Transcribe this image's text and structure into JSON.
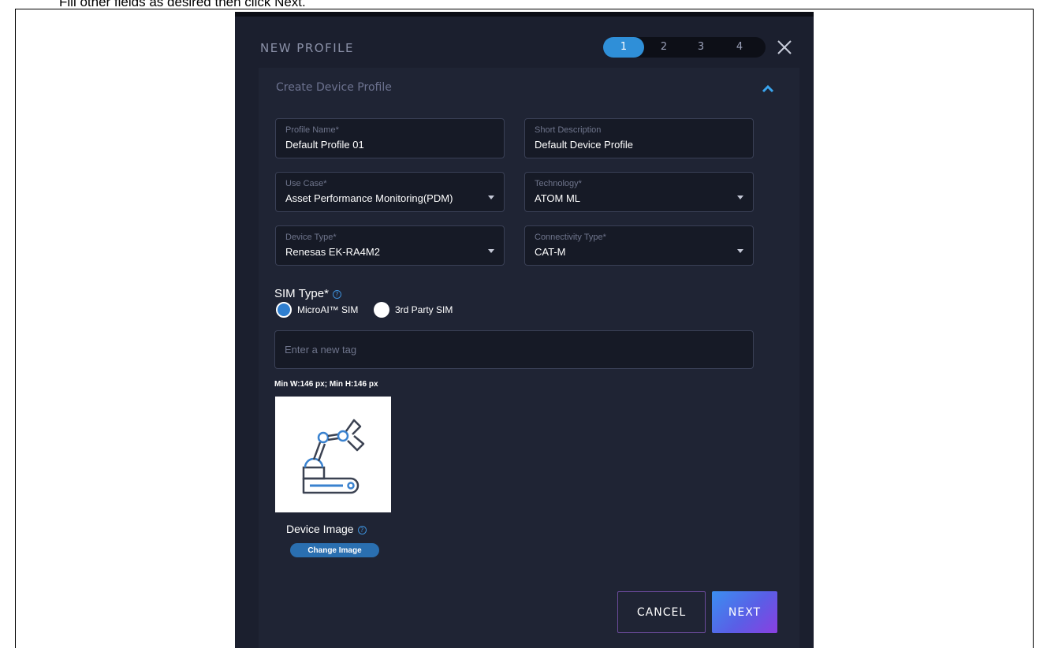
{
  "instruction_text": "Fill other fields as desired then click Next.",
  "modal": {
    "title": "NEW PROFILE",
    "steps": [
      "1",
      "2",
      "3",
      "4"
    ],
    "active_step": "1",
    "close_icon": "close-icon"
  },
  "section": {
    "title": "Create Device Profile",
    "collapse_icon": "chevron-up-icon"
  },
  "fields": {
    "profile_name": {
      "label": "Profile Name*",
      "value": "Default Profile 01"
    },
    "short_description": {
      "label": "Short Description",
      "value": "Default Device Profile"
    },
    "use_case": {
      "label": "Use Case*",
      "value": "Asset Performance Monitoring(PDM)"
    },
    "technology": {
      "label": "Technology*",
      "value": "ATOM ML"
    },
    "device_type": {
      "label": "Device Type*",
      "value": "Renesas EK-RA4M2"
    },
    "connectivity_type": {
      "label": "Connectivity Type*",
      "value": "CAT-M"
    }
  },
  "sim": {
    "label": "SIM Type*",
    "options": [
      "MicroAI™ SIM",
      "3rd Party SIM"
    ],
    "selected": "MicroAI™ SIM"
  },
  "tag_input": {
    "placeholder": "Enter a new tag",
    "value": ""
  },
  "image": {
    "min_size_text": "Min W:146 px;  Min H:146 px",
    "label": "Device Image",
    "change_button": "Change Image",
    "icon": "robot-arm-icon"
  },
  "buttons": {
    "cancel": "CANCEL",
    "next": "NEXT"
  },
  "colors": {
    "modal_bg": "#1b1f2e",
    "panel_bg": "#1f2434",
    "accent_blue": "#2f8fd8",
    "next_gradient_start": "#3b8ff0",
    "next_gradient_end": "#8a3fe0"
  }
}
